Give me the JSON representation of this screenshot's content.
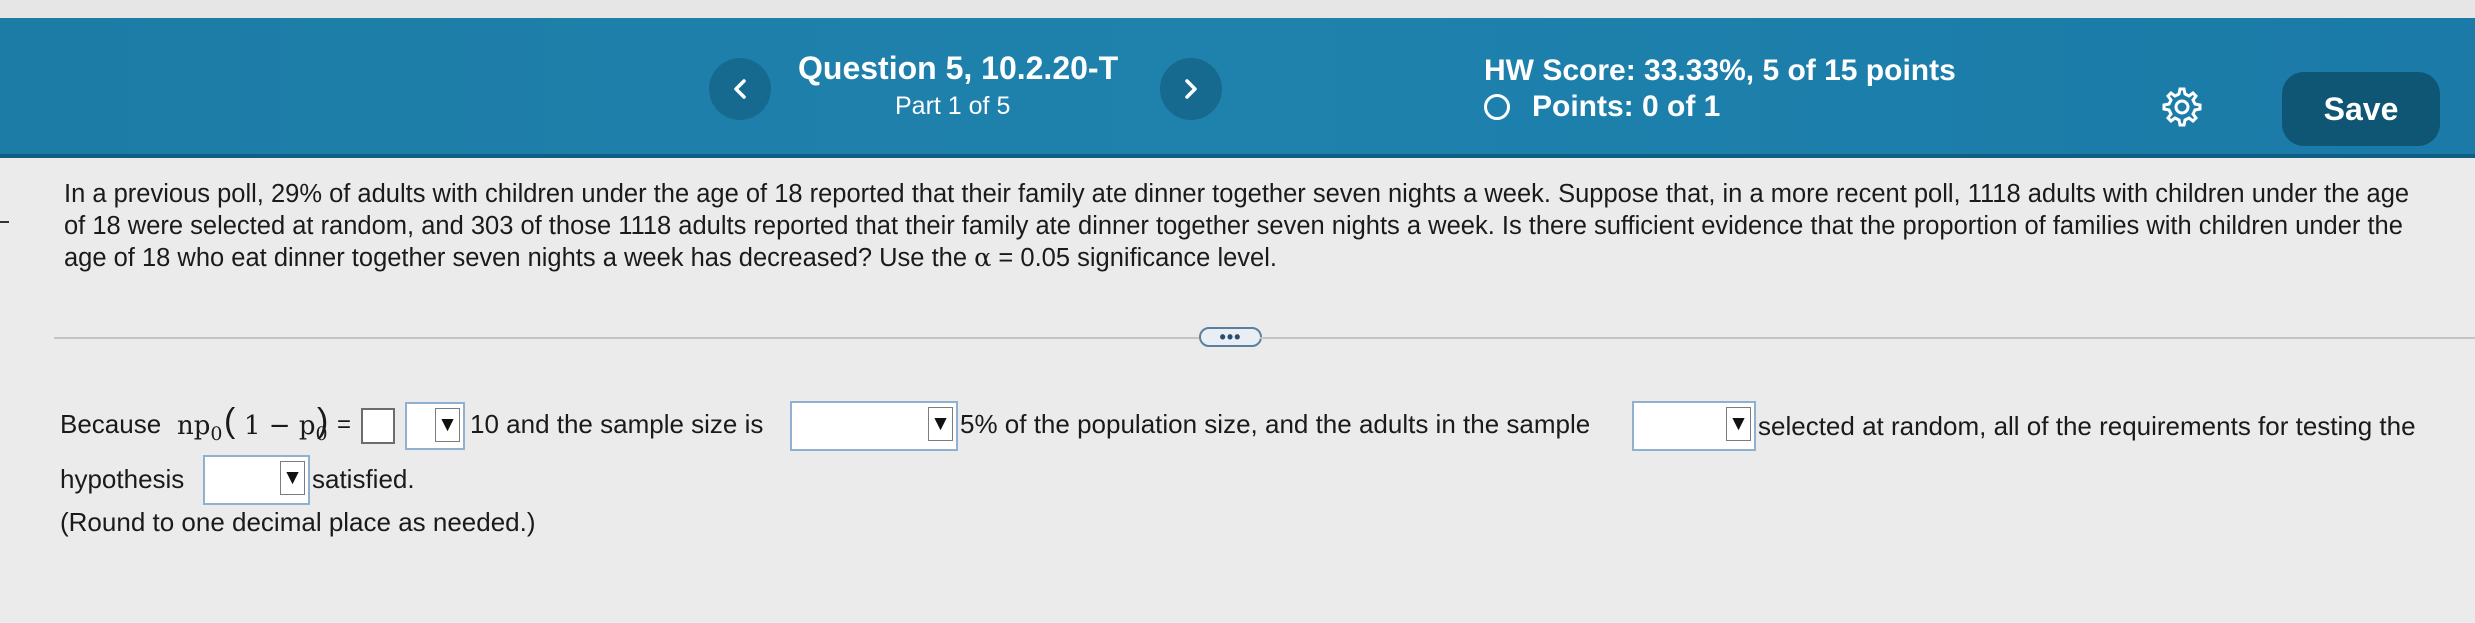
{
  "header": {
    "prev_icon": "chevron-left-icon",
    "next_icon": "chevron-right-icon",
    "question_title": "Question 5, 10.2.20-T",
    "part_label": "Part 1 of 5",
    "hw_score": "HW Score: 33.33%, 5 of 15 points",
    "points": "Points: 0 of 1",
    "settings_icon": "gear-icon",
    "save_label": "Save",
    "colors": {
      "bar": "#1e82ad",
      "save_button": "#0f5574"
    }
  },
  "question": {
    "text_before_alpha": "In a previous poll, 29% of adults with children under the age of 18 reported that their family ate dinner together seven nights a week. Suppose that, in a more recent poll, 1118 adults with children under the age of 18 were selected at random, and 303 of those 1118 adults reported that their family ate dinner together seven nights a week. Is there sufficient evidence that the proportion of families with children under the age of 18 who eat dinner together seven nights a week has decreased? Use the ",
    "alpha_symbol": "α",
    "text_after_alpha": " = 0.05 significance level."
  },
  "more_label": "•••",
  "answer": {
    "because": "Because",
    "np": "np",
    "p_sub": "0",
    "open_paren": "(",
    "one_minus": "1 − p",
    "close_paren": ")",
    "equals": "=",
    "ten_text": "10 and the sample size is",
    "five_pct_text": "5% of the population size, and the adults in the sample",
    "selected_text": "selected at random, all of the requirements for testing the",
    "hypothesis": "hypothesis",
    "satisfied": "satisfied.",
    "round_note": "(Round to one decimal place as needed.)",
    "dropdown_arrow": "▼"
  }
}
